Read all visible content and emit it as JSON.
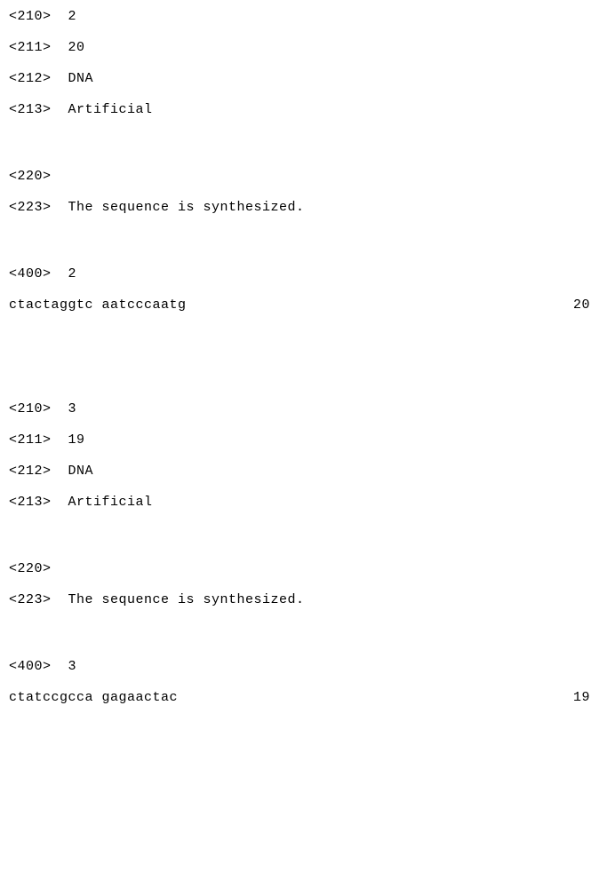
{
  "entries": [
    {
      "fields": {
        "210": "2",
        "211": "20",
        "212": "DNA",
        "213": "Artificial",
        "220": "",
        "223": "The sequence is synthesized.",
        "400": "2"
      },
      "sequence": "ctactaggtc aatcccaatg",
      "sequence_length": "20"
    },
    {
      "fields": {
        "210": "3",
        "211": "19",
        "212": "DNA",
        "213": "Artificial",
        "220": "",
        "223": "The sequence is synthesized.",
        "400": "3"
      },
      "sequence": "ctatccgcca gagaactac",
      "sequence_length": "19"
    }
  ],
  "labels": {
    "tag_210": "<210>  ",
    "tag_211": "<211>  ",
    "tag_212": "<212>  ",
    "tag_213": "<213>  ",
    "tag_220": "<220>",
    "tag_223": "<223>  ",
    "tag_400": "<400>  "
  }
}
